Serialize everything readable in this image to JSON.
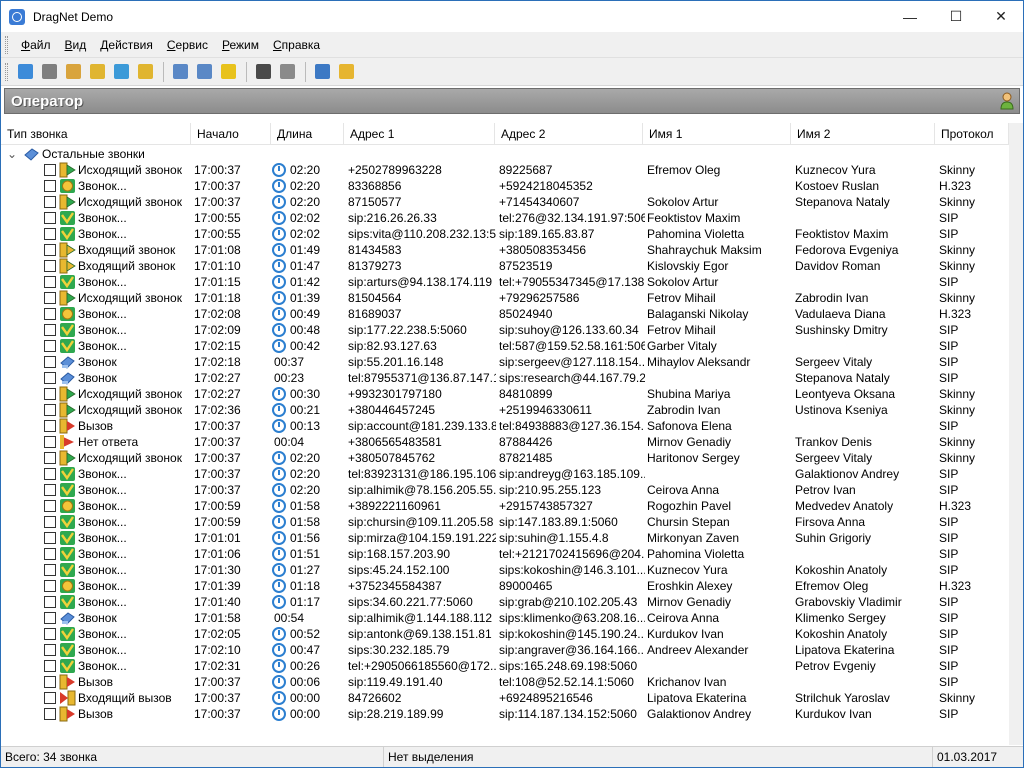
{
  "window": {
    "title": "DragNet Demo",
    "minimize": "—",
    "maximize": "☐",
    "close": "✕"
  },
  "menu": [
    {
      "u": "Ф",
      "rest": "айл"
    },
    {
      "u": "В",
      "rest": "ид"
    },
    {
      "u": "Д",
      "rest": "ействия"
    },
    {
      "u": "С",
      "rest": "ервис"
    },
    {
      "u": "Р",
      "rest": "ежим"
    },
    {
      "u": "С",
      "rest": "правка"
    }
  ],
  "toolbar": {
    "buttons": [
      {
        "name": "open-icon",
        "color": "#3d8bd9"
      },
      {
        "name": "print-icon",
        "color": "#7f7f7f"
      },
      {
        "name": "record-icon",
        "color": "#d9a43d"
      },
      {
        "name": "db-icon",
        "color": "#e0b530"
      },
      {
        "name": "network-icon",
        "color": "#3c9ad8"
      },
      {
        "name": "search-icon",
        "color": "#e0b530"
      },
      {
        "name": "sep"
      },
      {
        "name": "calendar-icon",
        "color": "#5a88c6"
      },
      {
        "name": "list-icon",
        "color": "#5a88c6"
      },
      {
        "name": "help-icon",
        "color": "#e8c21c"
      },
      {
        "name": "sep"
      },
      {
        "name": "headphones-icon",
        "color": "#4a4a4a"
      },
      {
        "name": "properties-icon",
        "color": "#8a8a8a"
      },
      {
        "name": "sep"
      },
      {
        "name": "details-view-icon",
        "color": "#3d79c4"
      },
      {
        "name": "calls-view-icon",
        "color": "#e6b530"
      }
    ]
  },
  "panel": {
    "title": "Оператор"
  },
  "columns": [
    "Тип звонка",
    "Начало",
    "Длина",
    "Адрес 1",
    "Адрес 2",
    "Имя 1",
    "Имя 2",
    "Протокол"
  ],
  "group": {
    "label": "Остальные звонки",
    "expander": "⌄"
  },
  "rows": [
    {
      "type": "Исходящий звонок",
      "icon": "out",
      "start": "17:00:37",
      "len": "02:20",
      "clock": true,
      "a1": "+2502789963228",
      "a2": "89225687",
      "n1": "Efremov Oleg",
      "n2": "Kuznecov Yura",
      "proto": "Skinny"
    },
    {
      "type": "Звонок...",
      "icon": "h323",
      "start": "17:00:37",
      "len": "02:20",
      "clock": true,
      "a1": "83368856",
      "a2": "+5924218045352",
      "n1": "",
      "n2": "Kostoev Ruslan",
      "proto": "H.323"
    },
    {
      "type": "Исходящий звонок",
      "icon": "out",
      "start": "17:00:37",
      "len": "02:20",
      "clock": true,
      "a1": "87150577",
      "a2": "+71454340607",
      "n1": "Sokolov Artur",
      "n2": "Stepanova Nataly",
      "proto": "Skinny"
    },
    {
      "type": "Звонок...",
      "icon": "sip",
      "start": "17:00:55",
      "len": "02:02",
      "clock": true,
      "a1": "sip:216.26.26.33",
      "a2": "tel:276@32.134.191.97:5060",
      "n1": "Feoktistov Maxim",
      "n2": "",
      "proto": "SIP"
    },
    {
      "type": "Звонок...",
      "icon": "sip",
      "start": "17:00:55",
      "len": "02:02",
      "clock": true,
      "a1": "sips:vita@110.208.232.13:5...",
      "a2": "sip:189.165.83.87",
      "n1": "Pahomina Violetta",
      "n2": "Feoktistov Maxim",
      "proto": "SIP"
    },
    {
      "type": "Входящий звонок",
      "icon": "in",
      "start": "17:01:08",
      "len": "01:49",
      "clock": true,
      "a1": "81434583",
      "a2": "+380508353456",
      "n1": "Shahraychuk Maksim",
      "n2": "Fedorova Evgeniya",
      "proto": "Skinny"
    },
    {
      "type": "Входящий звонок",
      "icon": "in",
      "start": "17:01:10",
      "len": "01:47",
      "clock": true,
      "a1": "81379273",
      "a2": "87523519",
      "n1": "Kislovskiy Egor",
      "n2": "Davidov Roman",
      "proto": "Skinny"
    },
    {
      "type": "Звонок...",
      "icon": "sip",
      "start": "17:01:15",
      "len": "01:42",
      "clock": true,
      "a1": "sip:arturs@94.138.174.119",
      "a2": "tel:+79055347345@17.138....",
      "n1": "Sokolov Artur",
      "n2": "",
      "proto": "SIP"
    },
    {
      "type": "Исходящий звонок",
      "icon": "out",
      "start": "17:01:18",
      "len": "01:39",
      "clock": true,
      "a1": "81504564",
      "a2": "+79296257586",
      "n1": "Fetrov Mihail",
      "n2": "Zabrodin Ivan",
      "proto": "Skinny"
    },
    {
      "type": "Звонок...",
      "icon": "h323",
      "start": "17:02:08",
      "len": "00:49",
      "clock": true,
      "a1": "81689037",
      "a2": "85024940",
      "n1": "Balaganski Nikolay",
      "n2": "Vadulaeva Diana",
      "proto": "H.323"
    },
    {
      "type": "Звонок...",
      "icon": "sip",
      "start": "17:02:09",
      "len": "00:48",
      "clock": true,
      "a1": "sip:177.22.238.5:5060",
      "a2": "sip:suhoy@126.133.60.34",
      "n1": "Fetrov Mihail",
      "n2": "Sushinsky Dmitry",
      "proto": "SIP"
    },
    {
      "type": "Звонок...",
      "icon": "sip",
      "start": "17:02:15",
      "len": "00:42",
      "clock": true,
      "a1": "sip:82.93.127.63",
      "a2": "tel:587@159.52.58.161:5060",
      "n1": "Garber Vitaly",
      "n2": "",
      "proto": "SIP"
    },
    {
      "type": "Звонок",
      "icon": "done",
      "start": "17:02:18",
      "len": "00:37",
      "clock": false,
      "a1": "sip:55.201.16.148",
      "a2": "sip:sergeev@127.118.154....",
      "n1": "Mihaylov Aleksandr",
      "n2": "Sergeev Vitaly",
      "proto": "SIP"
    },
    {
      "type": "Звонок",
      "icon": "done",
      "start": "17:02:27",
      "len": "00:23",
      "clock": false,
      "a1": "tel:87955371@136.87.147.1...",
      "a2": "sips:research@44.167.79.22",
      "n1": "",
      "n2": "Stepanova Nataly",
      "proto": "SIP"
    },
    {
      "type": "Исходящий звонок",
      "icon": "out",
      "start": "17:02:27",
      "len": "00:30",
      "clock": true,
      "a1": "+9932301797180",
      "a2": "84810899",
      "n1": "Shubina Mariya",
      "n2": "Leontyeva Oksana",
      "proto": "Skinny"
    },
    {
      "type": "Исходящий звонок",
      "icon": "out",
      "start": "17:02:36",
      "len": "00:21",
      "clock": true,
      "a1": "+380446457245",
      "a2": "+2519946330611",
      "n1": "Zabrodin Ivan",
      "n2": "Ustinova Kseniya",
      "proto": "Skinny"
    },
    {
      "type": "Вызов",
      "icon": "ring",
      "start": "17:00:37",
      "len": "00:13",
      "clock": true,
      "a1": "sip:account@181.239.133.80",
      "a2": "tel:84938883@127.36.154....",
      "n1": "Safonova Elena",
      "n2": "",
      "proto": "SIP"
    },
    {
      "type": "Нет ответа",
      "icon": "noans",
      "start": "17:00:37",
      "len": "00:04",
      "clock": false,
      "a1": "+3806565483581",
      "a2": "87884426",
      "n1": "Mirnov Genadiy",
      "n2": "Trankov Denis",
      "proto": "Skinny"
    },
    {
      "type": "Исходящий звонок",
      "icon": "out",
      "start": "17:00:37",
      "len": "02:20",
      "clock": true,
      "a1": "+380507845762",
      "a2": "87821485",
      "n1": "Haritonov Sergey",
      "n2": "Sergeev Vitaly",
      "proto": "Skinny"
    },
    {
      "type": "Звонок...",
      "icon": "sip",
      "start": "17:00:37",
      "len": "02:20",
      "clock": true,
      "a1": "tel:83923131@186.195.106....",
      "a2": "sip:andreyg@163.185.109....",
      "n1": "",
      "n2": "Galaktionov Andrey",
      "proto": "SIP"
    },
    {
      "type": "Звонок...",
      "icon": "sip",
      "start": "17:00:37",
      "len": "02:20",
      "clock": true,
      "a1": "sip:alhimik@78.156.205.55...",
      "a2": "sip:210.95.255.123",
      "n1": "Ceirova Anna",
      "n2": "Petrov Ivan",
      "proto": "SIP"
    },
    {
      "type": "Звонок...",
      "icon": "h323",
      "start": "17:00:59",
      "len": "01:58",
      "clock": true,
      "a1": "+3892221160961",
      "a2": "+2915743857327",
      "n1": "Rogozhin Pavel",
      "n2": "Medvedev Anatoly",
      "proto": "H.323"
    },
    {
      "type": "Звонок...",
      "icon": "sip",
      "start": "17:00:59",
      "len": "01:58",
      "clock": true,
      "a1": "sip:chursin@109.11.205.58",
      "a2": "sip:147.183.89.1:5060",
      "n1": "Chursin Stepan",
      "n2": "Firsova Anna",
      "proto": "SIP"
    },
    {
      "type": "Звонок...",
      "icon": "sip",
      "start": "17:01:01",
      "len": "01:56",
      "clock": true,
      "a1": "sip:mirza@104.159.191.222...",
      "a2": "sip:suhin@1.155.4.8",
      "n1": "Mirkonyan Zaven",
      "n2": "Suhin Grigoriy",
      "proto": "SIP"
    },
    {
      "type": "Звонок...",
      "icon": "sip",
      "start": "17:01:06",
      "len": "01:51",
      "clock": true,
      "a1": "sip:168.157.203.90",
      "a2": "tel:+2121702415696@204....",
      "n1": "Pahomina Violetta",
      "n2": "",
      "proto": "SIP"
    },
    {
      "type": "Звонок...",
      "icon": "sip",
      "start": "17:01:30",
      "len": "01:27",
      "clock": true,
      "a1": "sips:45.24.152.100",
      "a2": "sips:kokoshin@146.3.101....",
      "n1": "Kuznecov Yura",
      "n2": "Kokoshin Anatoly",
      "proto": "SIP"
    },
    {
      "type": "Звонок...",
      "icon": "h323",
      "start": "17:01:39",
      "len": "01:18",
      "clock": true,
      "a1": "+3752345584387",
      "a2": "89000465",
      "n1": "Eroshkin Alexey",
      "n2": "Efremov Oleg",
      "proto": "H.323"
    },
    {
      "type": "Звонок...",
      "icon": "sip",
      "start": "17:01:40",
      "len": "01:17",
      "clock": true,
      "a1": "sips:34.60.221.77:5060",
      "a2": "sip:grab@210.102.205.43",
      "n1": "Mirnov Genadiy",
      "n2": "Grabovskiy Vladimir",
      "proto": "SIP"
    },
    {
      "type": "Звонок",
      "icon": "done",
      "start": "17:01:58",
      "len": "00:54",
      "clock": false,
      "a1": "sip:alhimik@1.144.188.112",
      "a2": "sips:klimenko@63.208.16....",
      "n1": "Ceirova Anna",
      "n2": "Klimenko Sergey",
      "proto": "SIP"
    },
    {
      "type": "Звонок...",
      "icon": "sip",
      "start": "17:02:05",
      "len": "00:52",
      "clock": true,
      "a1": "sip:antonk@69.138.151.81",
      "a2": "sip:kokoshin@145.190.24....",
      "n1": "Kurdukov Ivan",
      "n2": "Kokoshin Anatoly",
      "proto": "SIP"
    },
    {
      "type": "Звонок...",
      "icon": "sip",
      "start": "17:02:10",
      "len": "00:47",
      "clock": true,
      "a1": "sips:30.232.185.79",
      "a2": "sip:angraver@36.164.166....",
      "n1": "Andreev Alexander",
      "n2": "Lipatova Ekaterina",
      "proto": "SIP"
    },
    {
      "type": "Звонок...",
      "icon": "sip",
      "start": "17:02:31",
      "len": "00:26",
      "clock": true,
      "a1": "tel:+2905066185560@172....",
      "a2": "sips:165.248.69.198:5060",
      "n1": "",
      "n2": "Petrov Evgeniy",
      "proto": "SIP"
    },
    {
      "type": "Вызов",
      "icon": "ring",
      "start": "17:00:37",
      "len": "00:06",
      "clock": true,
      "a1": "sip:119.49.191.40",
      "a2": "tel:108@52.52.14.1:5060",
      "n1": "Krichanov Ivan",
      "n2": "",
      "proto": "SIP"
    },
    {
      "type": "Входящий вызов",
      "icon": "inring",
      "start": "17:00:37",
      "len": "00:00",
      "clock": true,
      "a1": "84726602",
      "a2": "+6924895216546",
      "n1": "Lipatova Ekaterina",
      "n2": "Strilchuk Yaroslav",
      "proto": "Skinny"
    },
    {
      "type": "Вызов",
      "icon": "ring",
      "start": "17:00:37",
      "len": "00:00",
      "clock": true,
      "a1": "sip:28.219.189.99",
      "a2": "sip:114.187.134.152:5060",
      "n1": "Galaktionov Andrey",
      "n2": "Kurdukov Ivan",
      "proto": "SIP"
    }
  ],
  "status": {
    "total": "Всего: 34 звонка",
    "selection": "Нет выделения",
    "date": "01.03.2017"
  }
}
